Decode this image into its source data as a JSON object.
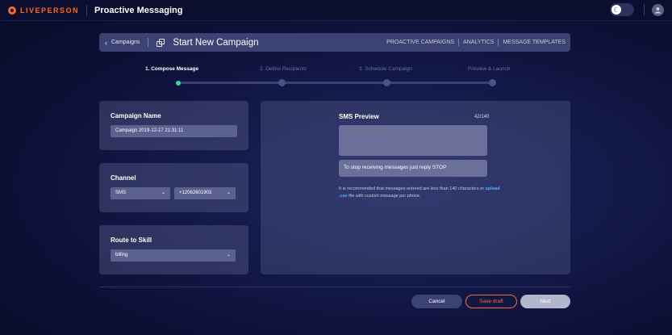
{
  "topbar": {
    "logo_text": "LIVEPERSON",
    "app_title": "Proactive Messaging",
    "theme_toggle_icon": "moon-icon",
    "user_icon": "user-avatar-icon"
  },
  "header": {
    "back_label": "Campaigns",
    "title": "Start New Campaign",
    "links": [
      "PROACTIVE CAMPAIGNS",
      "ANALYTICS",
      "MESSAGE TEMPLATES"
    ]
  },
  "steps": [
    {
      "label": "1. Compose Message",
      "active": true
    },
    {
      "label": "2. Define Recipients",
      "active": false
    },
    {
      "label": "3. Schedule Campaign",
      "active": false
    },
    {
      "label": "Preview & Launch",
      "active": false
    }
  ],
  "campaign_name": {
    "label": "Campaign Name",
    "value": "Campaign 2019-12-17 21:31:11"
  },
  "channel": {
    "label": "Channel",
    "type_value": "SMS",
    "number_value": "+12062601903"
  },
  "skill": {
    "label": "Route to Skill",
    "value": "billing"
  },
  "sms_preview": {
    "title": "SMS Preview",
    "count": "42/140",
    "placeholder": "Enter your message",
    "stop_message": "To stop receiving messages just reply STOP",
    "note_before": "It is recommended that messages entered are less than 140 characters or ",
    "note_link": "upload .csv",
    "note_after": " file with custom message per phone."
  },
  "buttons": {
    "cancel": "Cancel",
    "save_draft": "Save draft",
    "next": "Next"
  },
  "colors": {
    "accent_orange": "#ff6a1a",
    "active_step": "#2bd9a6",
    "link_blue": "#4cb3ff"
  }
}
